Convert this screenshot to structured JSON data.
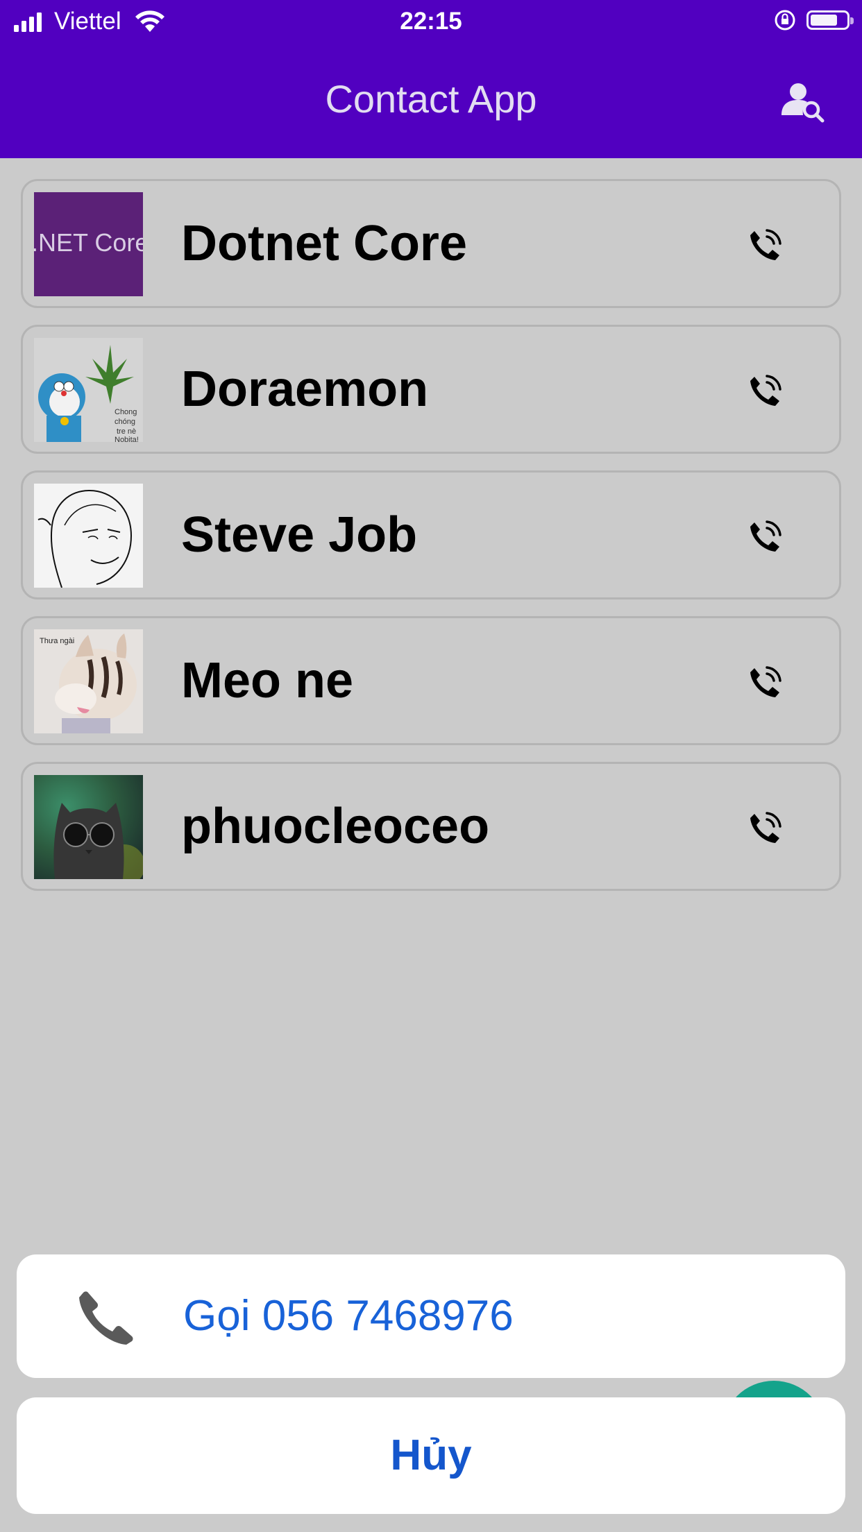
{
  "status_bar": {
    "carrier": "Viettel",
    "time": "22:15"
  },
  "header": {
    "title": "Contact App"
  },
  "contacts": [
    {
      "name": "Dotnet Core",
      "avatar_text": ".NET Core"
    },
    {
      "name": "Doraemon",
      "avatar_text": "Chong chóng tre nè Nobita!"
    },
    {
      "name": "Steve Job"
    },
    {
      "name": "Meo ne",
      "avatar_text": "Thưa ngài"
    },
    {
      "name": "phuocleoceo"
    }
  ],
  "action_sheet": {
    "call_label": "Gọi 056 7468976",
    "cancel_label": "Hủy"
  },
  "colors": {
    "header_bg": "#5100c0",
    "background": "#cbcbcb",
    "action_text": "#1862d8",
    "fab": "#14a38b"
  }
}
